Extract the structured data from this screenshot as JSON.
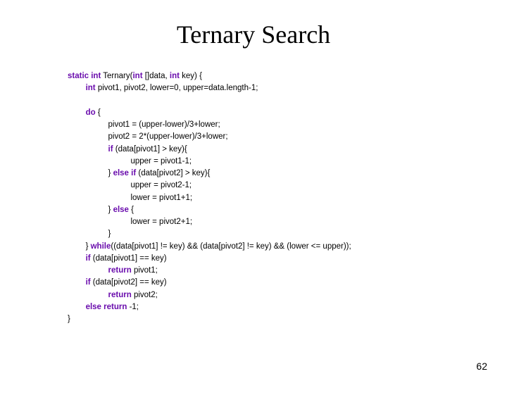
{
  "title": "Ternary Search",
  "pageNumber": "62",
  "kw": {
    "staticInt": "static int",
    "int1": "int",
    "int2": "int",
    "int3": "int",
    "do": "do",
    "if1": "if",
    "elseif": "else if",
    "else": "else",
    "while": "while",
    "if2": "if",
    "return1": "return",
    "if3": "if",
    "return2": "return",
    "elseReturn": "else return"
  },
  "code": {
    "sig1": " Ternary(",
    "sig2": " []data, ",
    "sig3": " key) {",
    "decl": " pivot1, pivot2, lower=0, upper=data.length-1;",
    "doOpen": " {",
    "p1": "pivot1 = (upper-lower)/3+lower;",
    "p2": "pivot2 = 2*(upper-lower)/3+lower;",
    "ifCond": " (data[pivot1] > key){",
    "u1": "upper = pivot1-1;",
    "elseifPre": "} ",
    "elseifCond": " (data[pivot2] > key){",
    "u2": "upper = pivot2-1;",
    "l1": "lower = pivot1+1;",
    "elsePre": "} ",
    "elseOpen": " {",
    "l2": "lower = pivot2+1;",
    "braceClose": "}",
    "whilePre": "} ",
    "whileCond": "((data[pivot1] != key) && (data[pivot2] != key) && (lower <= upper));",
    "ifk1": " (data[pivot1] == key)",
    "ret1": " pivot1;",
    "ifk2": " (data[pivot2] == key)",
    "ret2": " pivot2;",
    "retNeg": " -1;",
    "end": "}"
  }
}
